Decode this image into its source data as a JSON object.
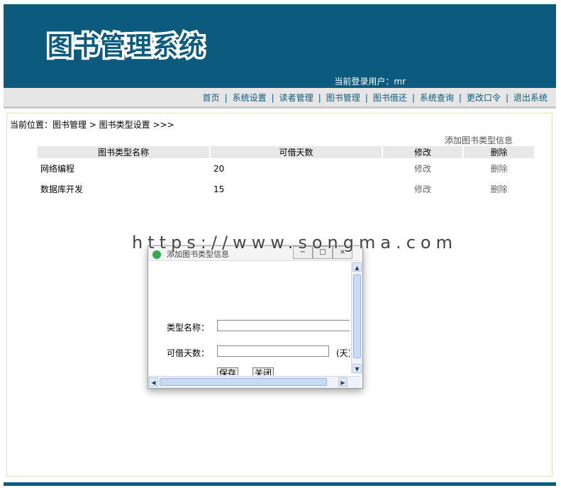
{
  "header": {
    "logo_text": "图书管理系统",
    "login_label": "当前登录用户：",
    "login_user": "mr"
  },
  "nav": {
    "items": [
      "首页",
      "系统设置",
      "读者管理",
      "图书管理",
      "图书借还",
      "系统查询",
      "更改口令",
      "退出系统"
    ],
    "separator": "|"
  },
  "breadcrumb": "当前位置：图书管理 > 图书类型设置 >>>",
  "add_link": "添加图书类型信息",
  "table": {
    "headers": [
      "图书类型名称",
      "可借天数",
      "修改",
      "删除"
    ],
    "rows": [
      {
        "name": "网络编程",
        "days": "20",
        "edit": "修改",
        "delete": "删除"
      },
      {
        "name": "数据库开发",
        "days": "15",
        "edit": "修改",
        "delete": "删除"
      }
    ]
  },
  "watermark": "https://www.songma.com",
  "modal": {
    "title": "添加图书类型信息",
    "type_name_label": "类型名称：",
    "type_name_value": "",
    "days_label": "可借天数：",
    "days_value": "",
    "days_unit": "(天)",
    "save_label": "保存",
    "close_label": "关闭"
  },
  "colors": {
    "brand": "#0d5a7f",
    "nav_background": "#e6e6e6"
  }
}
